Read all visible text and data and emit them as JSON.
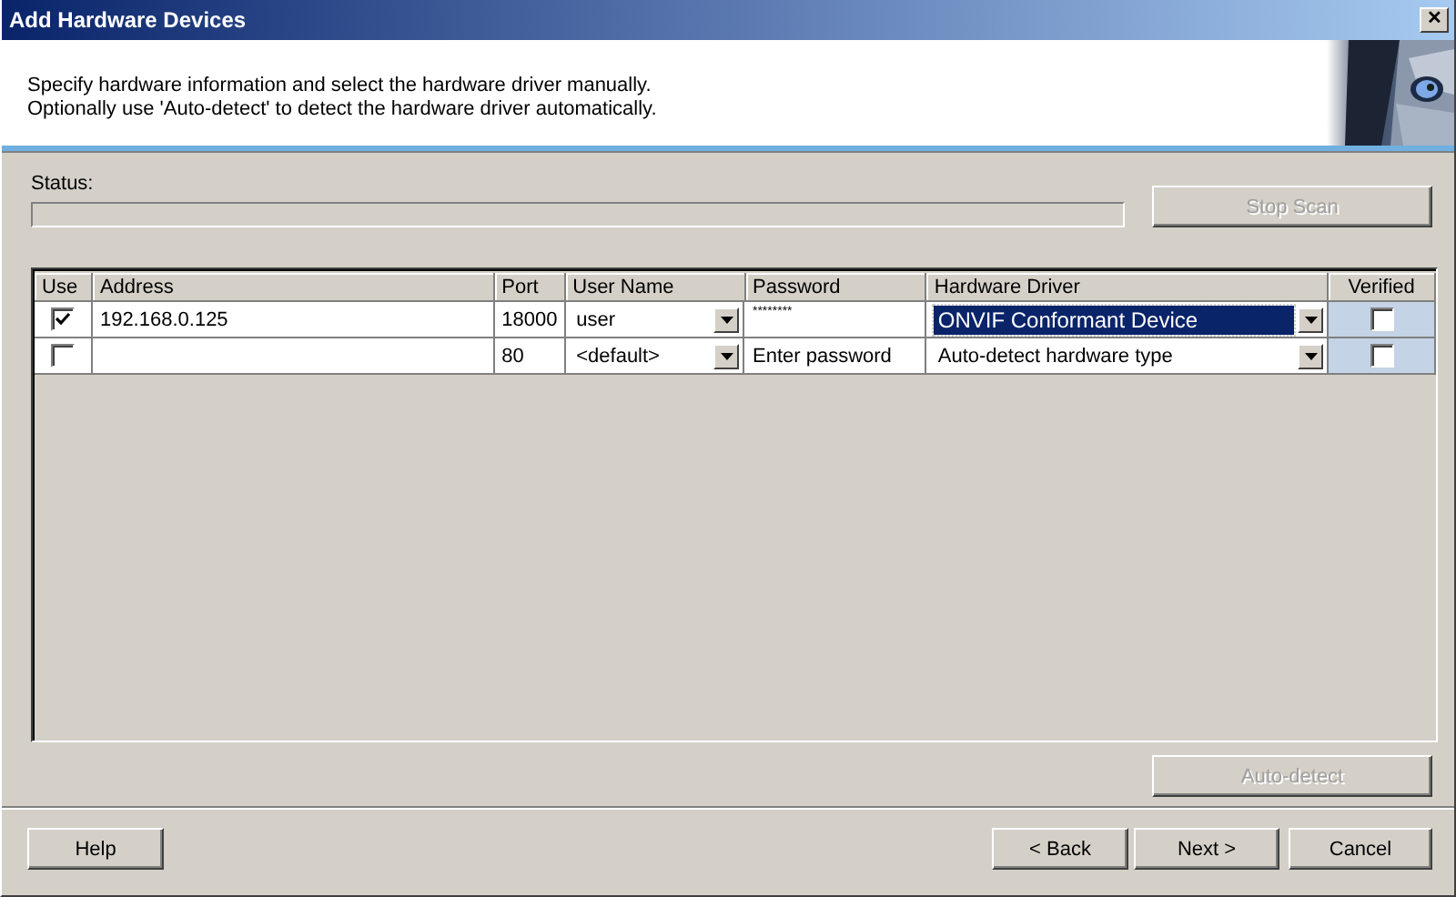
{
  "window": {
    "title": "Add Hardware Devices",
    "close": "✕"
  },
  "header": {
    "lines": [
      "Specify hardware information and select the hardware driver manually.",
      "Optionally use 'Auto-detect' to detect the hardware driver automatically."
    ]
  },
  "status": {
    "label": "Status:",
    "level": 0
  },
  "stop_scan": {
    "label": "Stop Scan",
    "disabled": true
  },
  "table": {
    "columns": [
      "Use",
      "Address",
      "Port",
      "User Name",
      "Password",
      "Hardware Driver",
      "Verified"
    ],
    "rows": [
      {
        "use": true,
        "address": "192.168.0.125",
        "port": "18000",
        "user_name": "user",
        "password": {
          "value": "********"
        },
        "driver": {
          "value": "ONVIF Conformant Device",
          "selected": true
        },
        "verified": false
      },
      {
        "use": false,
        "port": "80",
        "user_name": "<default>",
        "password": {
          "placeholder": "Enter password"
        },
        "driver": {
          "value": "Auto-detect hardware type",
          "selected": false
        },
        "verified": false
      }
    ]
  },
  "auto_detect": {
    "label": "Auto-detect",
    "disabled": true
  },
  "buttons": [
    {
      "label": "Help",
      "disabled": false
    },
    {
      "label": "< Back",
      "disabled": false
    },
    {
      "label": "Next >",
      "disabled": false
    },
    {
      "label": "Cancel",
      "disabled": false
    }
  ]
}
